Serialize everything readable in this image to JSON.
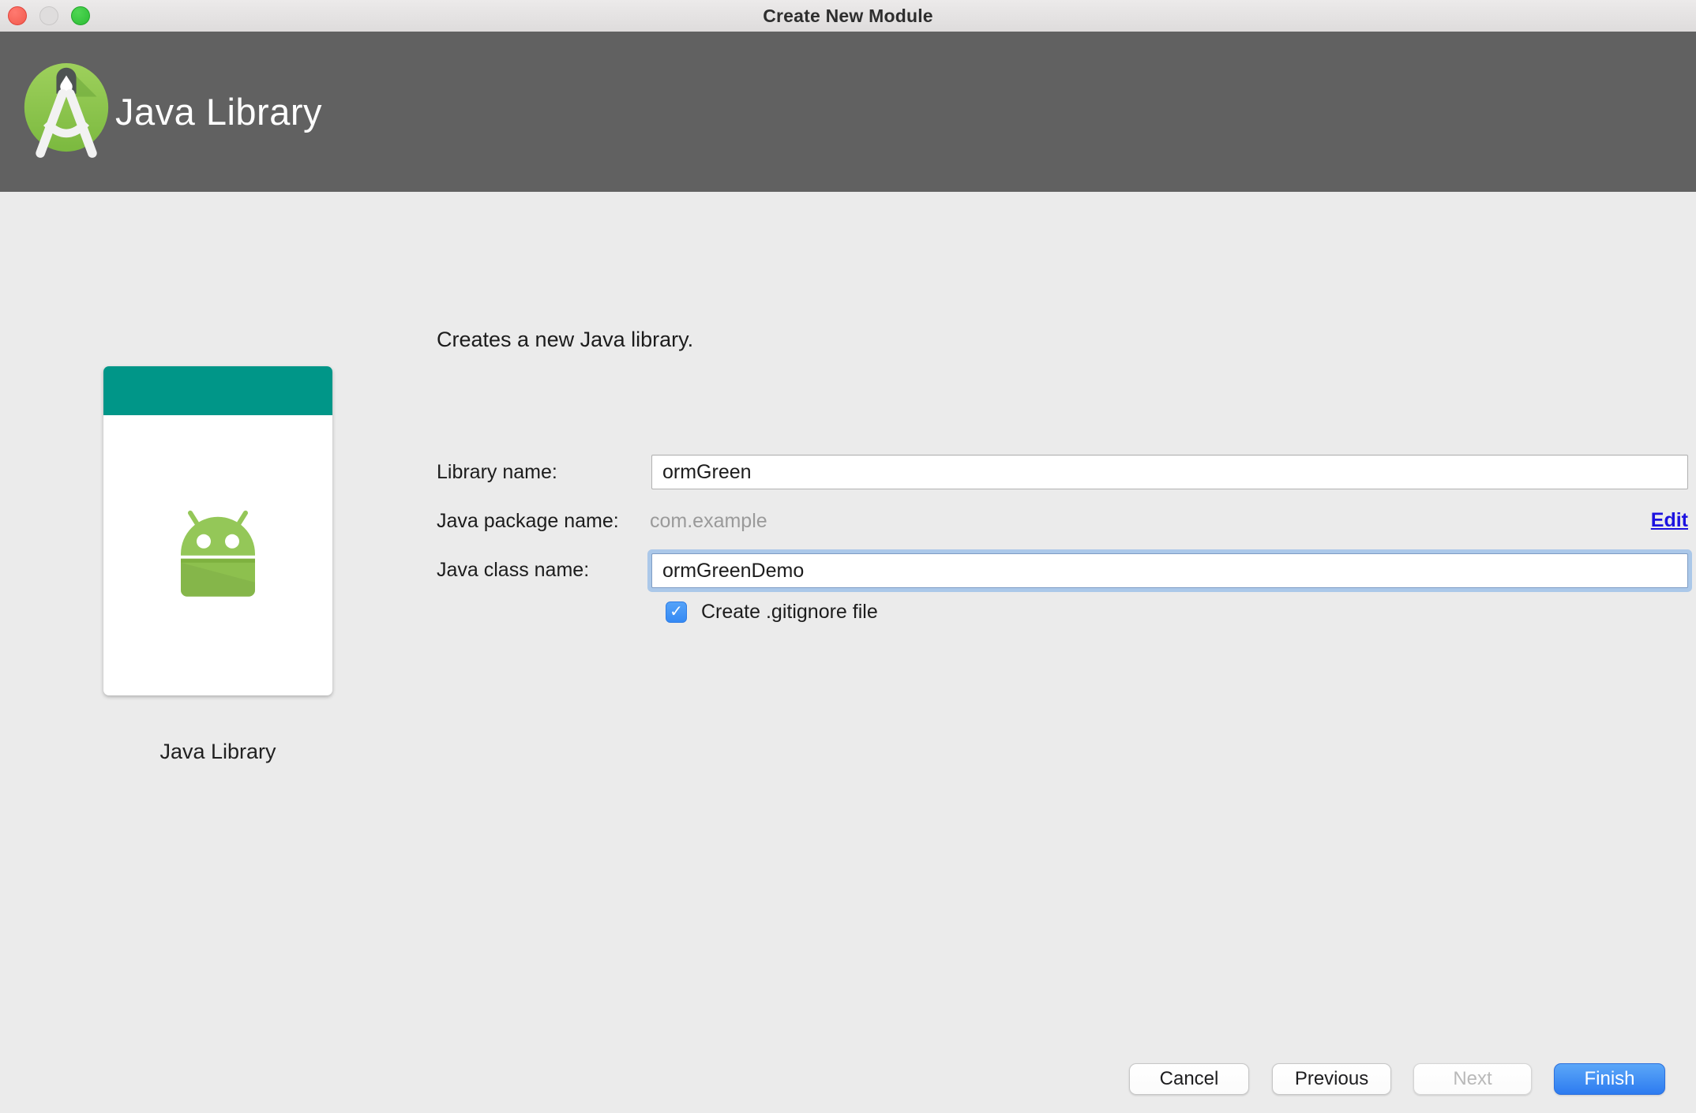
{
  "colors": {
    "header-bg": "#616161",
    "teal": "#009688",
    "content-bg": "#ebebeb",
    "checkbox-blue": "#4197f6",
    "link-blue": "#1c12e0",
    "focus-ring": "#abc8e9",
    "finish-blue": "#3b87f5",
    "android-green": "#8dc04e"
  },
  "window": {
    "title": "Create New Module"
  },
  "header": {
    "title": "Java Library"
  },
  "template_card": {
    "label": "Java Library"
  },
  "main": {
    "description": "Creates a new Java library.",
    "form": {
      "library_name": {
        "label": "Library name:",
        "value": "ormGreen"
      },
      "package_name": {
        "label": "Java package name:",
        "value": "com.example",
        "edit_label": "Edit"
      },
      "class_name": {
        "label": "Java class name:",
        "value": "ormGreenDemo",
        "focused": true
      },
      "gitignore": {
        "label": "Create .gitignore file",
        "checked": true,
        "checkmark": "✓"
      }
    }
  },
  "footer": {
    "buttons": [
      {
        "label": "Cancel",
        "state": "enabled",
        "style": "default"
      },
      {
        "label": "Previous",
        "state": "enabled",
        "style": "default"
      },
      {
        "label": "Next",
        "state": "disabled",
        "style": "default"
      },
      {
        "label": "Finish",
        "state": "enabled",
        "style": "primary"
      }
    ]
  }
}
